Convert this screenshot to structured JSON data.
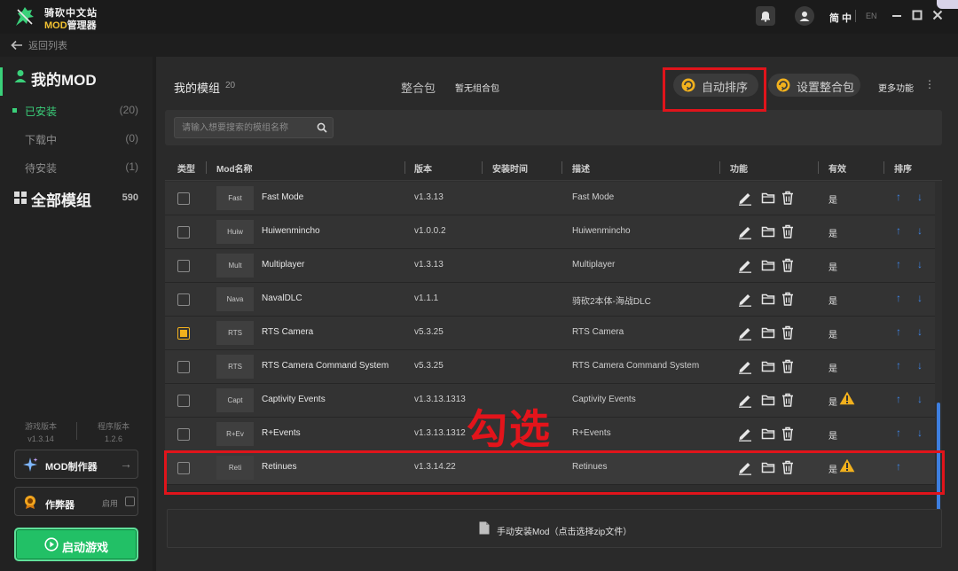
{
  "app": {
    "title_line1": "骑砍中文站",
    "title_line2_accent": "MOD",
    "title_line2_rest": "管理器",
    "lang_active": "简 中",
    "lang_other": "EN",
    "back_label": "返回列表"
  },
  "sidebar": {
    "my_mod": "我的MOD",
    "items": [
      {
        "label": "已安装",
        "count": "(20)"
      },
      {
        "label": "下载中",
        "count": "(0)"
      },
      {
        "label": "待安装",
        "count": "(1)"
      }
    ],
    "all_mods": {
      "label": "全部模组",
      "count": "590"
    },
    "game_version_label": "游戏版本",
    "game_version": "v1.3.14",
    "app_version_label": "程序版本",
    "app_version": "1.2.6",
    "maker_label": "MOD制作器",
    "cheat_label": "作弊器",
    "cheat_enable": "启用",
    "start_label": "启动游戏"
  },
  "main": {
    "title": "我的模组",
    "count": "20",
    "pack_label": "整合包",
    "pack_value": "暂无组合包",
    "auto_sort": "自动排序",
    "set_pack": "设置整合包",
    "more": "更多功能",
    "more_dots": "⋮",
    "search_placeholder": "请输入想要搜索的模组名称",
    "columns": {
      "type": "类型",
      "name": "Mod名称",
      "version": "版本",
      "install_time": "安装时间",
      "desc": "描述",
      "func": "功能",
      "valid": "有效",
      "sort": "排序"
    },
    "rows": [
      {
        "thumb": "Fast",
        "name": "Fast Mode",
        "version": "v1.3.13",
        "desc": "Fast Mode",
        "valid": "是",
        "checked": false,
        "warn": false,
        "down": true
      },
      {
        "thumb": "Huiw",
        "name": "Huiwenmincho",
        "version": "v1.0.0.2",
        "desc": "Huiwenmincho",
        "valid": "是",
        "checked": false,
        "warn": false,
        "down": true
      },
      {
        "thumb": "Mult",
        "name": "Multiplayer",
        "version": "v1.3.13",
        "desc": "Multiplayer",
        "valid": "是",
        "checked": false,
        "warn": false,
        "down": true
      },
      {
        "thumb": "Nava",
        "name": "NavalDLC",
        "version": "v1.1.1",
        "desc": "骑砍2本体-海战DLC",
        "valid": "是",
        "checked": false,
        "warn": false,
        "down": true
      },
      {
        "thumb": "RTS",
        "name": "RTS Camera",
        "version": "v5.3.25",
        "desc": "RTS Camera",
        "valid": "是",
        "checked": true,
        "warn": false,
        "down": true
      },
      {
        "thumb": "RTS",
        "name": "RTS Camera Command System",
        "version": "v5.3.25",
        "desc": "RTS Camera Command System",
        "valid": "是",
        "checked": false,
        "warn": false,
        "down": true
      },
      {
        "thumb": "Capt",
        "name": "Captivity Events",
        "version": "v1.3.13.1313",
        "desc": "Captivity Events",
        "valid": "是",
        "checked": false,
        "warn": true,
        "down": true
      },
      {
        "thumb": "R+Ev",
        "name": "R+Events",
        "version": "v1.3.13.1312",
        "desc": "R+Events",
        "valid": "是",
        "checked": false,
        "warn": false,
        "down": true
      },
      {
        "thumb": "Reti",
        "name": "Retinues",
        "version": "v1.3.14.22",
        "desc": "Retinues",
        "valid": "是",
        "checked": false,
        "warn": true,
        "down": false
      }
    ],
    "install_label": "手动安装Mod（点击选择zip文件）"
  },
  "annotation": {
    "text": "勾选"
  },
  "colors": {
    "accent_green": "#22c066",
    "accent_yellow": "#f2b11d",
    "arrow_blue": "#3e85e6",
    "annotation_red": "#e0141b"
  }
}
